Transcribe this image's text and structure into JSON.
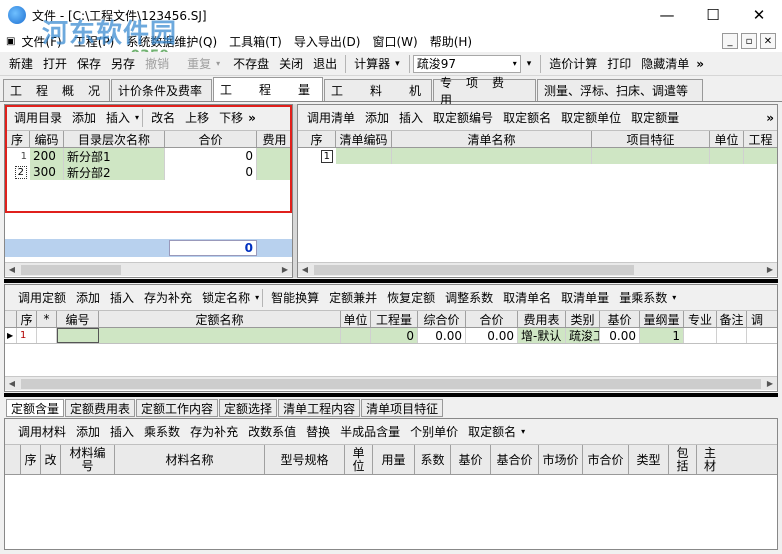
{
  "window": {
    "title": "文件 - [C:\\工程文件\\123456.SJ]",
    "minimize": "—",
    "maximize": "☐",
    "close": "✕"
  },
  "watermark": {
    "text": "河东软件园",
    "url": "pc0359.cn"
  },
  "menu": [
    "文件(F)",
    "工程(P)",
    "系统数据维护(Q)",
    "工具箱(T)",
    "导入导出(D)",
    "窗口(W)",
    "帮助(H)"
  ],
  "mdi_buttons": [
    "_",
    "▫",
    "✕"
  ],
  "toolbar": {
    "items": [
      "新建",
      "打开",
      "保存",
      "另存",
      "撤销",
      "重复",
      "不存盘",
      "关闭",
      "退出"
    ],
    "disabled": [
      "撤销",
      "重复"
    ],
    "calculator": "计算器",
    "quota_combo": "疏浚97",
    "right": [
      "造价计算",
      "打印",
      "隐藏清单"
    ],
    "more": "»"
  },
  "main_tabs": [
    "工　程　概　况",
    "计价条件及费率",
    "工　　程　　量",
    "工　　料　　机",
    "专　项　费　用",
    "测量、浮标、扫床、调遣等"
  ],
  "main_tab_active": 2,
  "left_panel": {
    "toolbar": [
      "调用目录",
      "添加",
      "插入",
      "改名",
      "上移",
      "下移"
    ],
    "columns": [
      "序",
      "编码",
      "目录层次名称",
      "合价",
      "费用"
    ],
    "rows": [
      {
        "seq": "1",
        "code": "200",
        "name": "新分部1",
        "price": "0"
      },
      {
        "seq": "2",
        "code": "300",
        "name": "新分部2",
        "price": "0"
      }
    ],
    "total": "0"
  },
  "right_panel": {
    "toolbar": [
      "调用清单",
      "添加",
      "插入",
      "取定额编号",
      "取定额名",
      "取定额单位",
      "取定额量"
    ],
    "columns": [
      "序",
      "清单编码",
      "清单名称",
      "项目特征",
      "单位",
      "工程"
    ],
    "rows": [
      {
        "seq": "1"
      }
    ]
  },
  "quota_panel": {
    "toolbar": [
      "调用定额",
      "添加",
      "插入",
      "存为补充",
      "锁定名称",
      "智能换算",
      "定额兼并",
      "恢复定额",
      "调整系数",
      "取清单名",
      "取清单量",
      "量乘系数"
    ],
    "columns": [
      "序",
      "*",
      "编号",
      "定额名称",
      "单位",
      "工程量",
      "综合价",
      "合价",
      "费用表",
      "类别",
      "基价",
      "量纲量",
      "专业",
      "备注",
      "调"
    ],
    "rows": [
      {
        "seq": "1",
        "qty": "0",
        "unit_price": "0.00",
        "total": "0.00",
        "fee_table": "增-默认",
        "category": "疏浚工",
        "base_price": "0.00",
        "dim": "1"
      }
    ]
  },
  "bottom_tabs": [
    "定额含量",
    "定额费用表",
    "定额工作内容",
    "定额选择",
    "清单工程内容",
    "清单项目特征"
  ],
  "bottom_tab_active": 0,
  "material_panel": {
    "toolbar": [
      "调用材料",
      "添加",
      "插入",
      "乘系数",
      "存为补充",
      "改数系值",
      "替换",
      "半成品含量",
      "个别单价",
      "取定额名"
    ],
    "columns": [
      "序",
      "改",
      "材料编号",
      "材料名称",
      "型号规格",
      "单位",
      "用量",
      "系数",
      "基价",
      "基合价",
      "市场价",
      "市合价",
      "类型",
      "包括",
      "主材"
    ]
  }
}
